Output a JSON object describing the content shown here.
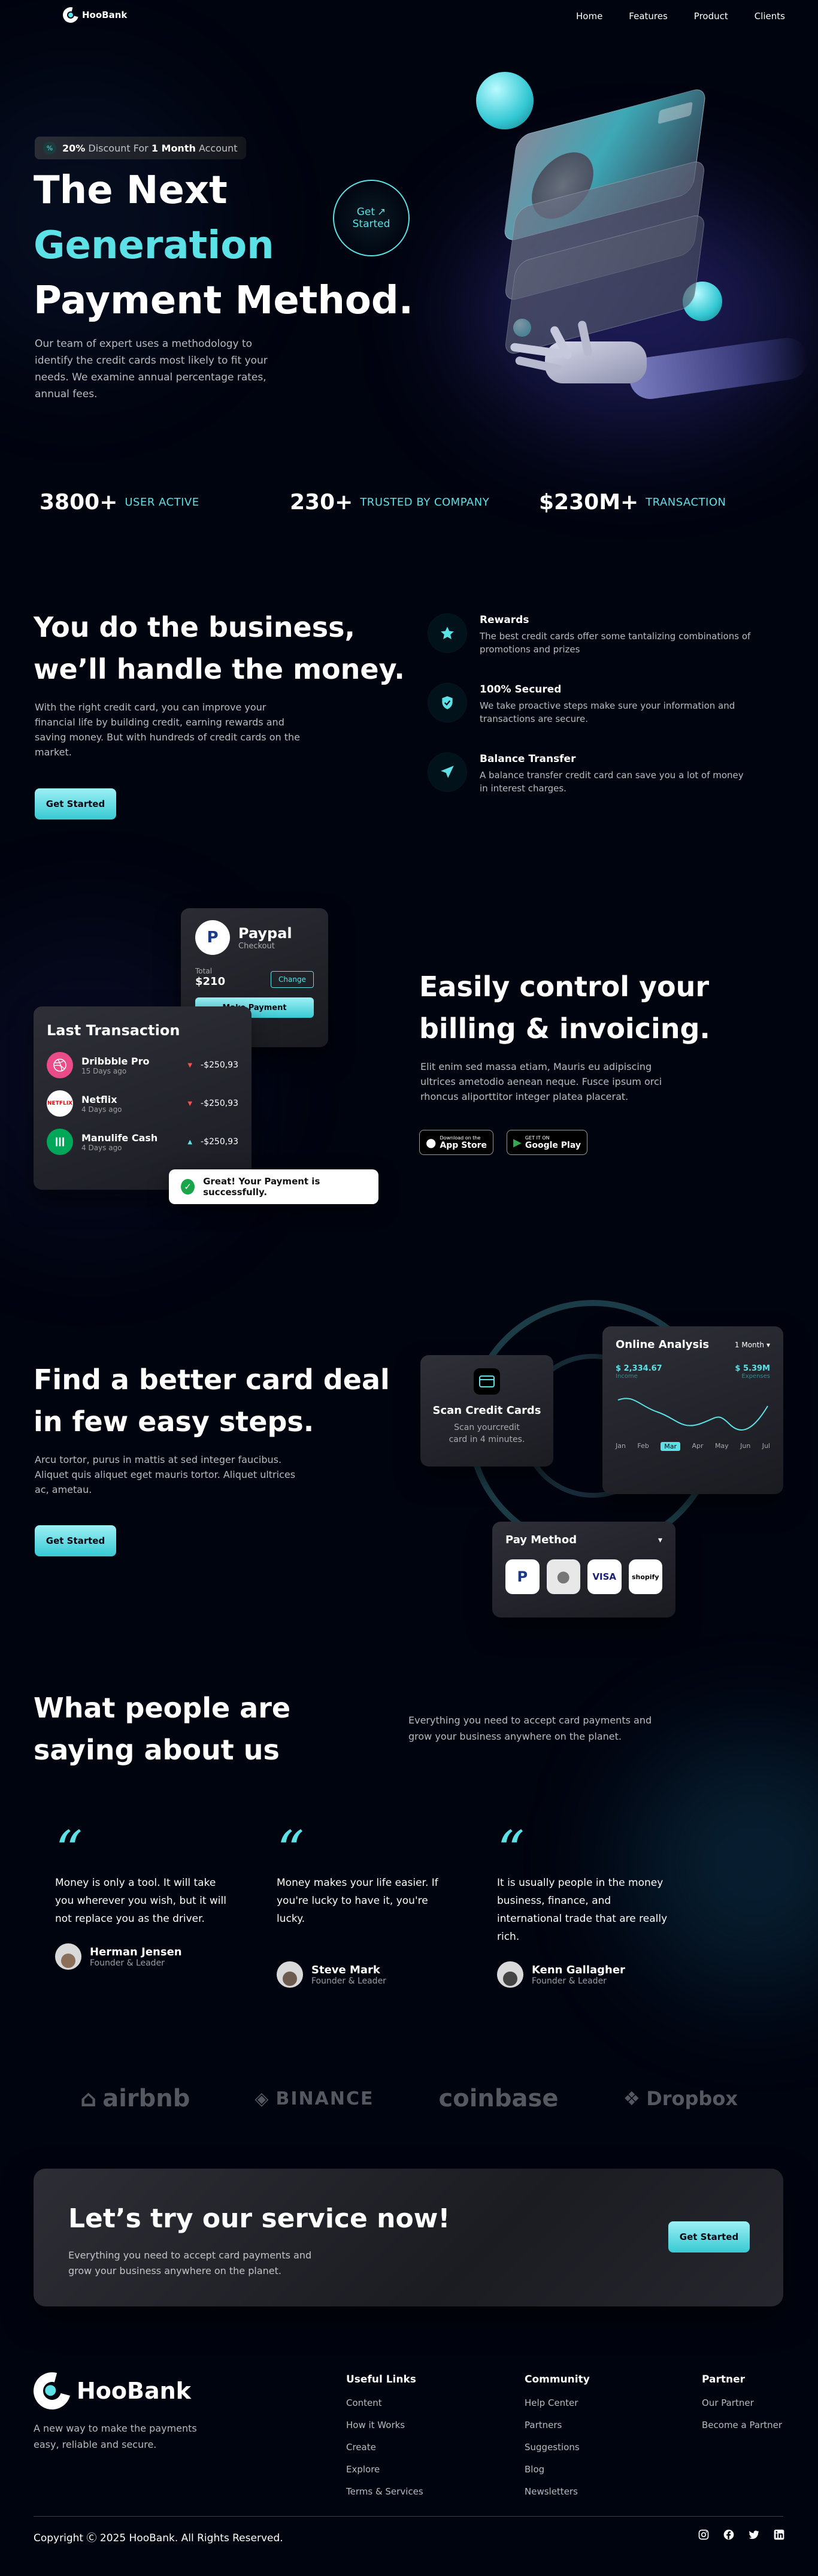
{
  "nav": {
    "brand": "HooBank",
    "links": [
      "Home",
      "Features",
      "Product",
      "Clients"
    ]
  },
  "hero": {
    "badge_highlight": "20%",
    "badge_text_1": "Discount For",
    "badge_highlight_2": "1 Month",
    "badge_text_2": "Account",
    "title_line1": "The Next",
    "title_line2": "Generation",
    "title_line3": "Payment Method.",
    "description": "Our team of expert uses a methodology to identify the credit cards most likely to fit your needs. We examine annual percentage rates, annual fees.",
    "cta_line1": "Get",
    "cta_line2": "Started"
  },
  "stats": [
    {
      "value": "3800+",
      "label": "USER ACTIVE"
    },
    {
      "value": "230+",
      "label": "TRUSTED BY COMPANY"
    },
    {
      "value": "$230M+",
      "label": "TRANSACTION"
    }
  ],
  "business": {
    "title_line1": "You do the business,",
    "title_line2": "we’ll handle the money.",
    "description": "With the right credit card, you can improve your financial life by building credit, earning rewards and saving money. But with hundreds of credit cards on the market.",
    "button": "Get Started",
    "features": [
      {
        "icon": "star-icon",
        "title": "Rewards",
        "text": "The best credit cards offer some tantalizing combinations of promotions and prizes"
      },
      {
        "icon": "shield-icon",
        "title": "100% Secured",
        "text": "We take proactive steps make sure your information and transactions are secure."
      },
      {
        "icon": "send-icon",
        "title": "Balance Transfer",
        "text": "A balance transfer credit card can save you a lot of money in interest charges."
      }
    ]
  },
  "billing": {
    "paypal_title": "Paypal",
    "paypal_sub": "Checkout",
    "total_label": "Total",
    "total_value": "$210",
    "change_button": "Change",
    "make_payment": "Make Payment",
    "last_tx_title": "Last Transaction",
    "transactions": [
      {
        "name": "Dribbble Pro",
        "time": "15 Days ago",
        "amount": "-$250,93",
        "logo": "dribbble-logo"
      },
      {
        "name": "Netflix",
        "time": "4 Days ago",
        "amount": "-$250,93",
        "logo": "netflix-logo",
        "logo_text": "NETFLIX"
      },
      {
        "name": "Manulife Cash",
        "time": "4 Days ago",
        "amount": "-$250,93",
        "logo": "manulife-logo"
      }
    ],
    "toast": "Great! Your Payment is successfully.",
    "title_line1": "Easily control your",
    "title_line2": "billing & invoicing.",
    "description": "Elit enim sed massa etiam, Mauris eu adipiscing ultrices ametodio aenean neque. Fusce ipsum orci rhoncus aliporttitor integer platea placerat.",
    "appstore_small": "Download on the",
    "appstore_big": "App Store",
    "googleplay_small": "GET IT ON",
    "googleplay_big": "Google Play"
  },
  "carddeal": {
    "title_line1": "Find a better card deal",
    "title_line2": "in few easy steps.",
    "description": "Arcu tortor, purus in mattis at sed integer faucibus. Aliquet quis aliquet eget mauris tortor. Aliquet ultrices ac, ametau.",
    "button": "Get Started",
    "scan_title": "Scan Credit Cards",
    "scan_text": "Scan yourcredit card in 4 minutes.",
    "analysis_title": "Online Analysis",
    "analysis_period": "1 Month",
    "income_value": "$ 2,334.67",
    "income_label": "Income",
    "expense_value": "$ 5.39M",
    "expense_label": "Expenses",
    "months": [
      "Jan",
      "Feb",
      "Mar",
      "Apr",
      "May",
      "Jun",
      "Jul"
    ],
    "active_month": "Mar",
    "paymethod_title": "Pay Method",
    "paymethods": [
      "paypal-icon",
      "apple-icon",
      "VISA",
      "shopify"
    ]
  },
  "testimonials": {
    "title_line1": "What people are",
    "title_line2": "saying about us",
    "description": "Everything you need to accept card payments and grow your business anywhere on the planet.",
    "items": [
      {
        "text": "Money is only a tool. It will take you wherever you wish, but it will not replace you as the driver.",
        "name": "Herman Jensen",
        "role": "Founder & Leader"
      },
      {
        "text": "Money makes your life easier. If you're lucky to have it, you're lucky.",
        "name": "Steve Mark",
        "role": "Founder & Leader"
      },
      {
        "text": "It is usually people in the money business, finance, and international trade that are really rich.",
        "name": "Kenn Gallagher",
        "role": "Founder & Leader"
      }
    ]
  },
  "clients": [
    "airbnb",
    "BINANCE",
    "coinbase",
    "Dropbox"
  ],
  "cta": {
    "title": "Let’s try our service now!",
    "description": "Everything you need to accept card payments and grow your business anywhere on the planet.",
    "button": "Get Started"
  },
  "footer": {
    "brand": "HooBank",
    "tagline": "A new way to make the payments easy, reliable and secure.",
    "columns": [
      {
        "title": "Useful Links",
        "links": [
          "Content",
          "How it Works",
          "Create",
          "Explore",
          "Terms & Services"
        ]
      },
      {
        "title": "Community",
        "links": [
          "Help Center",
          "Partners",
          "Suggestions",
          "Blog",
          "Newsletters"
        ]
      },
      {
        "title": "Partner",
        "links": [
          "Our Partner",
          "Become a Partner"
        ]
      }
    ],
    "copyright": "Copyright Ⓒ 2025 HooBank. All Rights Reserved.",
    "socials": [
      "instagram-icon",
      "facebook-icon",
      "twitter-icon",
      "linkedin-icon"
    ]
  },
  "colors": {
    "background": "#00040f",
    "accent": "#5ce1e6",
    "button_gradient_top": "#9df0f5",
    "button_gradient_bottom": "#38c9d3",
    "panel": "#2b2c33"
  }
}
